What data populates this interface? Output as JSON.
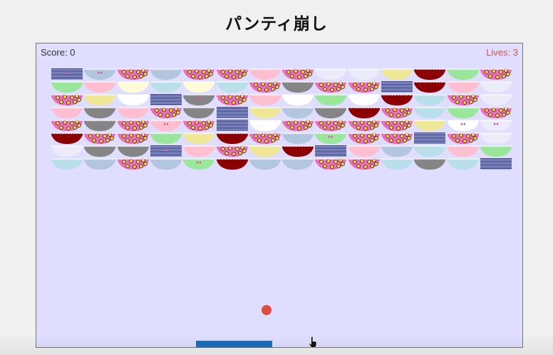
{
  "header": {
    "title": "パンティ崩し"
  },
  "hud": {
    "score": "Score: 0",
    "lives": "Lives: 3"
  },
  "icons": {
    "pointer": "hand-pointer-icon"
  },
  "palette": {
    "B": "#b3c6df",
    "P": "#ffbfd0",
    "W": "#ffffff",
    "Y": "#efe796",
    "G": "#9ae69a",
    "D": "#858585",
    "R": "#8b0000",
    "L": "#b9e0ea",
    "V": "#ebebfa",
    "C": "#fffbd6",
    "F": "#ee6fb5",
    "S": "#1f2f7a",
    "bow": "#e0559a",
    "lace": "#ffffff"
  },
  "bricks": [
    [
      "S",
      "B",
      "F",
      "B",
      "F",
      "F",
      "P",
      "F",
      "V",
      "V",
      "Y",
      "R",
      "G",
      "F"
    ],
    [
      "G",
      "P",
      "C",
      "L",
      "C",
      "L",
      "F",
      "D",
      "F",
      "F",
      "S",
      "R",
      "P",
      "V"
    ],
    [
      "F",
      "Y",
      "W",
      "S",
      "D",
      "F",
      "P",
      "W",
      "G",
      "W",
      "R",
      "L",
      "F",
      "V"
    ],
    [
      "P",
      "D",
      "P",
      "F",
      "D",
      "S",
      "Y",
      "B",
      "D",
      "R",
      "F",
      "L",
      "G",
      "F"
    ],
    [
      "F",
      "D",
      "F",
      "P",
      "F",
      "S",
      "W",
      "F",
      "F",
      "F",
      "F",
      "Y",
      "W",
      "V"
    ],
    [
      "R",
      "F",
      "F",
      "G",
      "Y",
      "R",
      "F",
      "B",
      "G",
      "F",
      "F",
      "S",
      "F",
      "V"
    ],
    [
      "V",
      "D",
      "D",
      "S",
      "P",
      "F",
      "Y",
      "R",
      "S",
      "P",
      "B",
      "L",
      "P",
      "G"
    ],
    [
      "L",
      "B",
      "F",
      "B",
      "G",
      "R",
      "B",
      "B",
      "F",
      "F",
      "L",
      "D",
      "L",
      "S"
    ]
  ],
  "bow_cells": [
    [
      0,
      0
    ],
    [
      1,
      0
    ],
    [
      4,
      2
    ],
    [
      3,
      4
    ],
    [
      4,
      4
    ],
    [
      12,
      4
    ],
    [
      13,
      4
    ],
    [
      6,
      5
    ],
    [
      8,
      5
    ],
    [
      3,
      6
    ],
    [
      4,
      7
    ],
    [
      7,
      8
    ],
    [
      6,
      9
    ],
    [
      11,
      9
    ],
    [
      7,
      10
    ],
    [
      4,
      11
    ]
  ]
}
